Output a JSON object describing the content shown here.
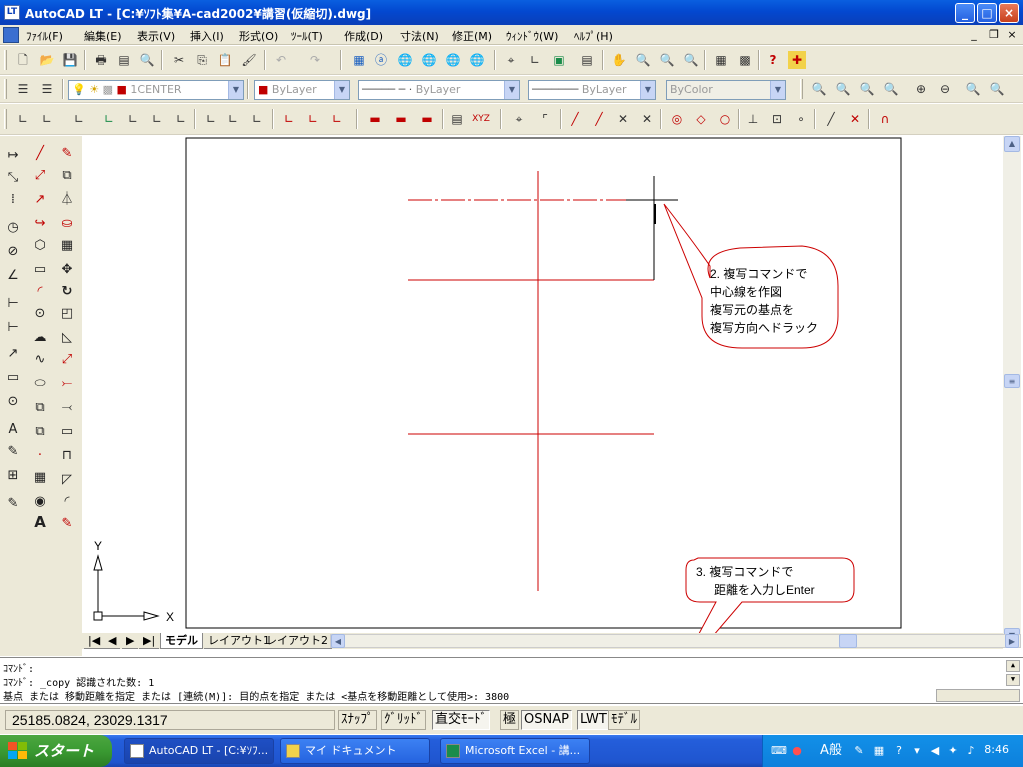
{
  "window": {
    "title": "AutoCAD LT - [C:¥ｿﾌﾄ集¥A-cad2002¥講習(仮縮切).dwg]",
    "app_icon_text": "LT",
    "min_label": "_",
    "max_label": "□",
    "close_label": "×"
  },
  "menu": {
    "items": [
      "ﾌｧｲﾙ(F)",
      "編集(E)",
      "表示(V)",
      "挿入(I)",
      "形式(O)",
      "ﾂｰﾙ(T)",
      "作成(D)",
      "寸法(N)",
      "修正(M)",
      "ｳｨﾝﾄﾞｳ(W)",
      "ﾍﾙﾌﾟ(H)"
    ],
    "mdi_min": "_",
    "mdi_restore": "❐",
    "mdi_close": "×"
  },
  "layers_toolbar": {
    "layer_value": "1CENTER",
    "color_value": "ByLayer",
    "linetype_value": "ByLayer",
    "lineweight_value": "ByLayer",
    "plotstyle_value": "ByColor"
  },
  "drawing": {
    "callout2_lines": [
      "2. 複写コマンドで",
      "中心線を作図",
      "複写元の基点を",
      "複写方向へドラック"
    ],
    "callout3_lines": [
      "3. 複写コマンドで",
      "距離を入力しEnter"
    ],
    "ucs_x": "X",
    "ucs_y": "Y",
    "colors": {
      "red": "#cc0000",
      "cyan": "#00c0c0",
      "line": "#000000"
    }
  },
  "tabs": {
    "nav": [
      "|◀",
      "◀",
      "▶",
      "▶|"
    ],
    "items": [
      "モデル",
      "レイアウト1",
      "レイアウト2"
    ]
  },
  "command": {
    "line1": "ｺﾏﾝﾄﾞ:",
    "line2": "ｺﾏﾝﾄﾞ: _copy 認識された数: 1",
    "line3": "基点 または 移動距離を指定 または [連続(M)]: 目的点を指定 または <基点を移動距離として使用>: 3800"
  },
  "status": {
    "coords": "25185.0824, 23029.1317",
    "toggles": [
      "ｽﾅｯﾌﾟ",
      "ｸﾞﾘｯﾄﾞ",
      "直交ﾓｰﾄﾞ",
      "極",
      "OSNAP",
      "LWT",
      "ﾓﾃﾞﾙ"
    ]
  },
  "taskbar": {
    "start_label": "スタート",
    "items": [
      "AutoCAD LT - [C:¥ｿﾌ...",
      "マイ ドキュメント",
      "Microsoft Excel - 講..."
    ],
    "ime_label": "A般",
    "clock": "8:46"
  }
}
